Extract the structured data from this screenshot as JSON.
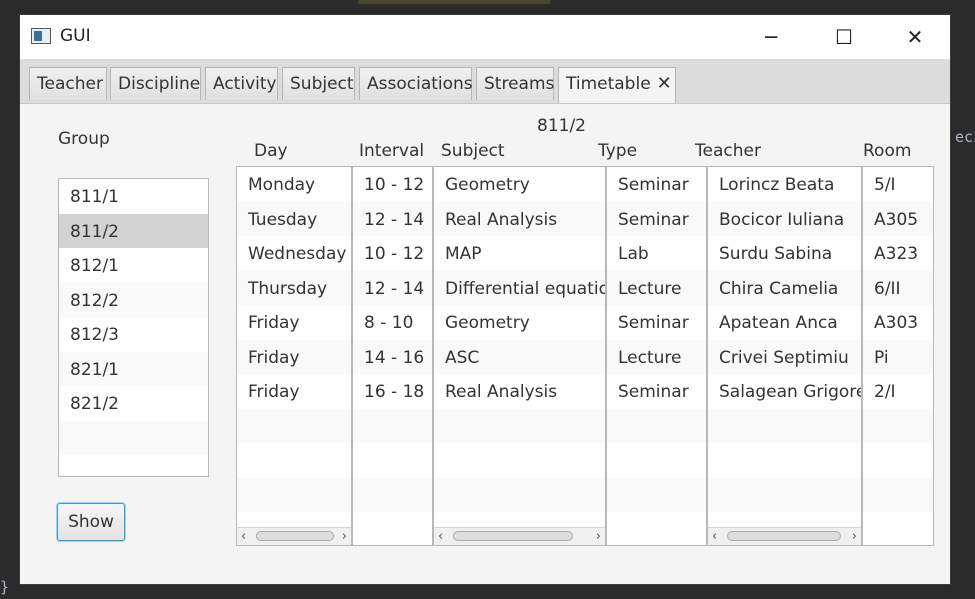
{
  "window": {
    "title": "GUI",
    "minimize_glyph": "─",
    "maximize_glyph": "☐",
    "close_glyph": "✕"
  },
  "tabs": [
    {
      "label": "Teacher"
    },
    {
      "label": "Discipline"
    },
    {
      "label": "Activity"
    },
    {
      "label": "Subject"
    },
    {
      "label": "Associations"
    },
    {
      "label": "Streams"
    },
    {
      "label": "Timetable",
      "active": true,
      "close": "✕"
    }
  ],
  "group_panel": {
    "label": "Group",
    "items": [
      "811/1",
      "811/2",
      "812/1",
      "812/2",
      "812/3",
      "821/1",
      "821/2"
    ],
    "selected": "811/2",
    "show_button": "Show"
  },
  "timetable": {
    "title": "811/2",
    "headers": {
      "day": "Day",
      "interval": "Interval",
      "subject": "Subject",
      "type": "Type",
      "teacher": "Teacher",
      "room": "Room"
    },
    "days": [
      "Monday",
      "Tuesday",
      "Wednesday",
      "Thursday",
      "Friday",
      "Friday",
      "Friday"
    ],
    "intervals": [
      "10 - 12",
      "12 - 14",
      "10 - 12",
      "12 - 14",
      "8 - 10",
      "14 - 16",
      "16 - 18"
    ],
    "subjects": [
      "Geometry",
      "Real Analysis",
      "MAP",
      "Differential equations",
      "Geometry",
      "ASC",
      "Real Analysis"
    ],
    "types": [
      "Seminar",
      "Seminar",
      "Lab",
      "Lecture",
      "Seminar",
      "Lecture",
      "Seminar"
    ],
    "teachers": [
      "Lorincz Beata",
      "Bocicor Iuliana",
      "Surdu Sabina",
      "Chira Camelia",
      "Apatean Anca",
      "Crivei Septimiu",
      "Salagean Grigore"
    ],
    "rooms": [
      "5/I",
      "A305",
      "A323",
      "6/II",
      "A303",
      "Pi",
      "2/I"
    ]
  },
  "background": {
    "code_fragment_right": "eci",
    "code_fragment_left": "}"
  },
  "colors": {
    "selection": "#d2d2d2",
    "focus_border": "#3a99d9",
    "window_bg": "#f4f4f4"
  }
}
